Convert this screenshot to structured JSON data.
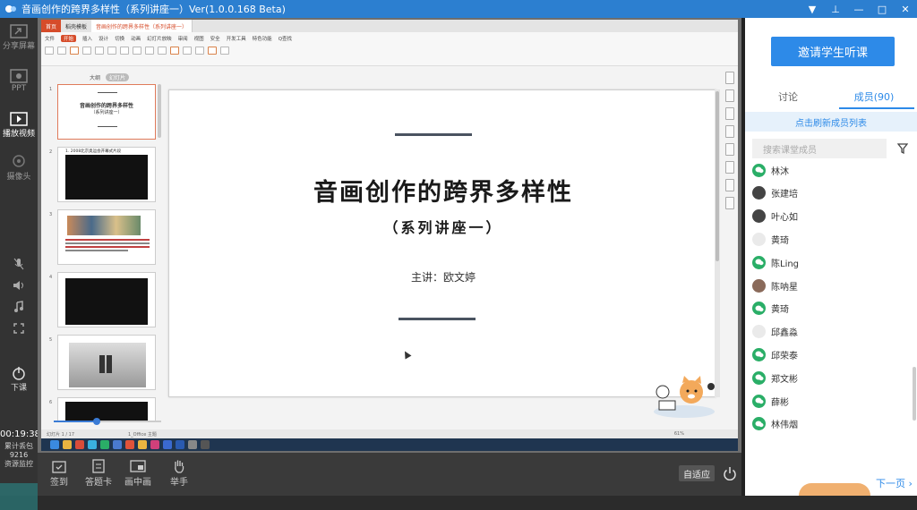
{
  "window": {
    "title": "音画创作的跨界多样性（系列讲座一）Ver(1.0.0.168 Beta)",
    "controls": [
      "▼",
      "⊥",
      "—",
      "□",
      "✕"
    ]
  },
  "left_bar": {
    "share_screen": "分享屏幕",
    "ppt": "PPT",
    "play_video": "播放视频",
    "camera": "摄像头",
    "end_class": "下课",
    "timer": "00:19:38",
    "packet_loss_label": "累计丢包",
    "packet_loss_value": "9216",
    "resource_monitor": "资源监控"
  },
  "wps": {
    "tabs": [
      "首页",
      "稻壳模板",
      "音画创作的跨界多样性（系列讲座一）"
    ],
    "menu": [
      "文件",
      "开始",
      "插入",
      "设计",
      "切换",
      "动画",
      "幻灯片放映",
      "审阅",
      "视图",
      "安全",
      "开发工具",
      "特色功能",
      "Q查找"
    ],
    "active_menu": "开始",
    "outline_label": "大纲",
    "slides_label": "幻灯片",
    "thumb1_title": "音画创作的跨界多样性",
    "thumb1_subtitle": "（系列讲座一）",
    "thumb2_caption": "1. 2008北京奥运会开幕式片段",
    "thumb_numbers": [
      "1",
      "2",
      "3",
      "4",
      "5",
      "6"
    ],
    "status_left": "幻灯片 1 / 17",
    "status_theme": "1_Office 主题",
    "zoom": "61%"
  },
  "slide": {
    "title": "音画创作的跨界多样性",
    "subtitle": "（系列讲座一）",
    "speaker": "主讲：欧文婷"
  },
  "bottom_bar": {
    "signin": "签到",
    "answer_card": "答题卡",
    "pip": "画中画",
    "raise_hand": "举手",
    "adaptive": "自适应"
  },
  "right_panel": {
    "invite_button": "邀请学生听课",
    "tab_discussion": "讨论",
    "tab_members": "成员(90)",
    "refresh_hint": "点击刷新成员列表",
    "search_placeholder": "搜索课堂成员",
    "members": [
      {
        "name": "林沐",
        "avatar": "wechat"
      },
      {
        "name": "张建培",
        "avatar": "dark"
      },
      {
        "name": "叶心如",
        "avatar": "dark"
      },
      {
        "name": "黄琦",
        "avatar": "light"
      },
      {
        "name": "陈Ling",
        "avatar": "wechat"
      },
      {
        "name": "陈呐星",
        "avatar": "photo"
      },
      {
        "name": "黄琦",
        "avatar": "wechat"
      },
      {
        "name": "邱鑫淼",
        "avatar": "light"
      },
      {
        "name": "邱荣泰",
        "avatar": "wechat"
      },
      {
        "name": "郑文彬",
        "avatar": "wechat"
      },
      {
        "name": "薛彬",
        "avatar": "wechat"
      },
      {
        "name": "林伟烟",
        "avatar": "wechat"
      }
    ],
    "next_page": "下一页"
  },
  "colors": {
    "title_bar": "#2c7fd0",
    "accent": "#2d8ae8",
    "wechat_green": "#2aae67",
    "wps_orange": "#d64c2a"
  }
}
